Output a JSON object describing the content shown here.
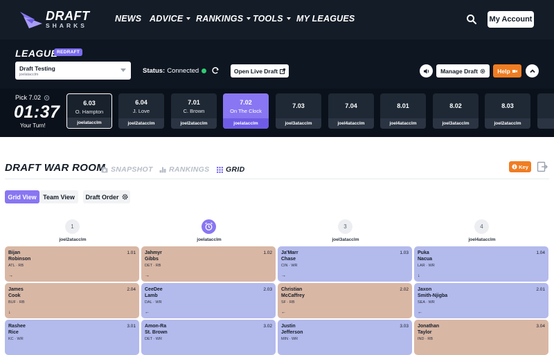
{
  "nav": {
    "logo_line1": "DRAFT",
    "logo_line2": "SHARKS",
    "items": [
      {
        "label": "NEWS",
        "dropdown": false
      },
      {
        "label": "ADVICE",
        "dropdown": true
      },
      {
        "label": "RANKINGS",
        "dropdown": true
      },
      {
        "label": "TOOLS",
        "dropdown": true
      },
      {
        "label": "MY LEAGUES",
        "dropdown": false
      }
    ],
    "account_label": "My Account",
    "search_icon": "search-icon"
  },
  "league": {
    "title": "LEAGUE",
    "badge": "REDRAFT",
    "selected_name": "Draft Testing",
    "selected_user": "joelatacclm",
    "status_label": "Status:",
    "status_value": "Connected",
    "status_color": "#2ecc71",
    "open_live_label": "Open Live Draft",
    "manage_label": "Manage Draft",
    "help_label": "Help",
    "accent_color": "#f07d22"
  },
  "clock": {
    "pick_label": "Pick 7.02",
    "timer": "01:37",
    "turn_text": "Your Turn!"
  },
  "picks": [
    {
      "num": "6.03",
      "player": "O. Hampton",
      "owner": "joelatacclm",
      "state": "drafted"
    },
    {
      "num": "6.04",
      "player": "J. Love",
      "owner": "joel2atacclm",
      "state": "past"
    },
    {
      "num": "7.01",
      "player": "C. Brown",
      "owner": "joel2atacclm",
      "state": "past"
    },
    {
      "num": "7.02",
      "player": "On The Clock",
      "owner": "joelatacclm",
      "state": "active"
    },
    {
      "num": "7.03",
      "player": "",
      "owner": "joel3atacclm",
      "state": "future"
    },
    {
      "num": "7.04",
      "player": "",
      "owner": "joel4atacclm",
      "state": "future"
    },
    {
      "num": "8.01",
      "player": "",
      "owner": "joel4atacclm",
      "state": "future"
    },
    {
      "num": "8.02",
      "player": "",
      "owner": "joel3atacclm",
      "state": "future"
    },
    {
      "num": "8.03",
      "player": "",
      "owner": "joel2atacclm",
      "state": "future"
    }
  ],
  "warroom": {
    "title": "DRAFT WAR ROOM",
    "tabs": [
      {
        "label": "SNAPSHOT",
        "icon": "camera-icon",
        "active": false
      },
      {
        "label": "RANKINGS",
        "icon": "rankings-icon",
        "active": false
      },
      {
        "label": "GRID",
        "icon": "grid-icon",
        "active": true
      }
    ],
    "key_label": "Key",
    "views": {
      "grid": "Grid View",
      "team": "Team View",
      "order": "Draft Order"
    }
  },
  "columns": [
    {
      "slot": "1",
      "team": "joel2atacclm",
      "on_clock": false
    },
    {
      "slot": "",
      "team": "joelatacclm",
      "on_clock": true
    },
    {
      "slot": "3",
      "team": "joel3atacclm",
      "on_clock": false
    },
    {
      "slot": "4",
      "team": "joel4atacclm",
      "on_clock": false
    }
  ],
  "grid": [
    {
      "first": "Bijan",
      "last": "Robinson",
      "meta": "ATL · RB",
      "pick": "1.01",
      "pos": "RB",
      "arrow": "→"
    },
    {
      "first": "Jahmyr",
      "last": "Gibbs",
      "meta": "DET · RB",
      "pick": "1.02",
      "pos": "RB",
      "arrow": "→"
    },
    {
      "first": "Ja'Marr",
      "last": "Chase",
      "meta": "CIN · WR",
      "pick": "1.03",
      "pos": "WR",
      "arrow": "→"
    },
    {
      "first": "Puka",
      "last": "Nacua",
      "meta": "LAR · WR",
      "pick": "1.04",
      "pos": "WR",
      "arrow": "↓"
    },
    {
      "first": "James",
      "last": "Cook",
      "meta": "BUF · RB",
      "pick": "2.04",
      "pos": "RB",
      "arrow": "↓"
    },
    {
      "first": "CeeDee",
      "last": "Lamb",
      "meta": "DAL · WR",
      "pick": "2.03",
      "pos": "WR",
      "arrow": "←"
    },
    {
      "first": "Christian",
      "last": "McCaffrey",
      "meta": "SF · RB",
      "pick": "2.02",
      "pos": "RB",
      "arrow": "←"
    },
    {
      "first": "Jaxon",
      "last": "Smith-Njigba",
      "meta": "SEA · WR",
      "pick": "2.01",
      "pos": "WR",
      "arrow": "←"
    },
    {
      "first": "Rashee",
      "last": "Rice",
      "meta": "KC · WR",
      "pick": "3.01",
      "pos": "WR",
      "arrow": ""
    },
    {
      "first": "Amon-Ra",
      "last": "St. Brown",
      "meta": "DET · WR",
      "pick": "3.02",
      "pos": "WR",
      "arrow": ""
    },
    {
      "first": "Justin",
      "last": "Jefferson",
      "meta": "MIN · WR",
      "pick": "3.03",
      "pos": "WR",
      "arrow": ""
    },
    {
      "first": "Jonathan",
      "last": "Taylor",
      "meta": "IND · RB",
      "pick": "3.04",
      "pos": "RB",
      "arrow": ""
    }
  ]
}
